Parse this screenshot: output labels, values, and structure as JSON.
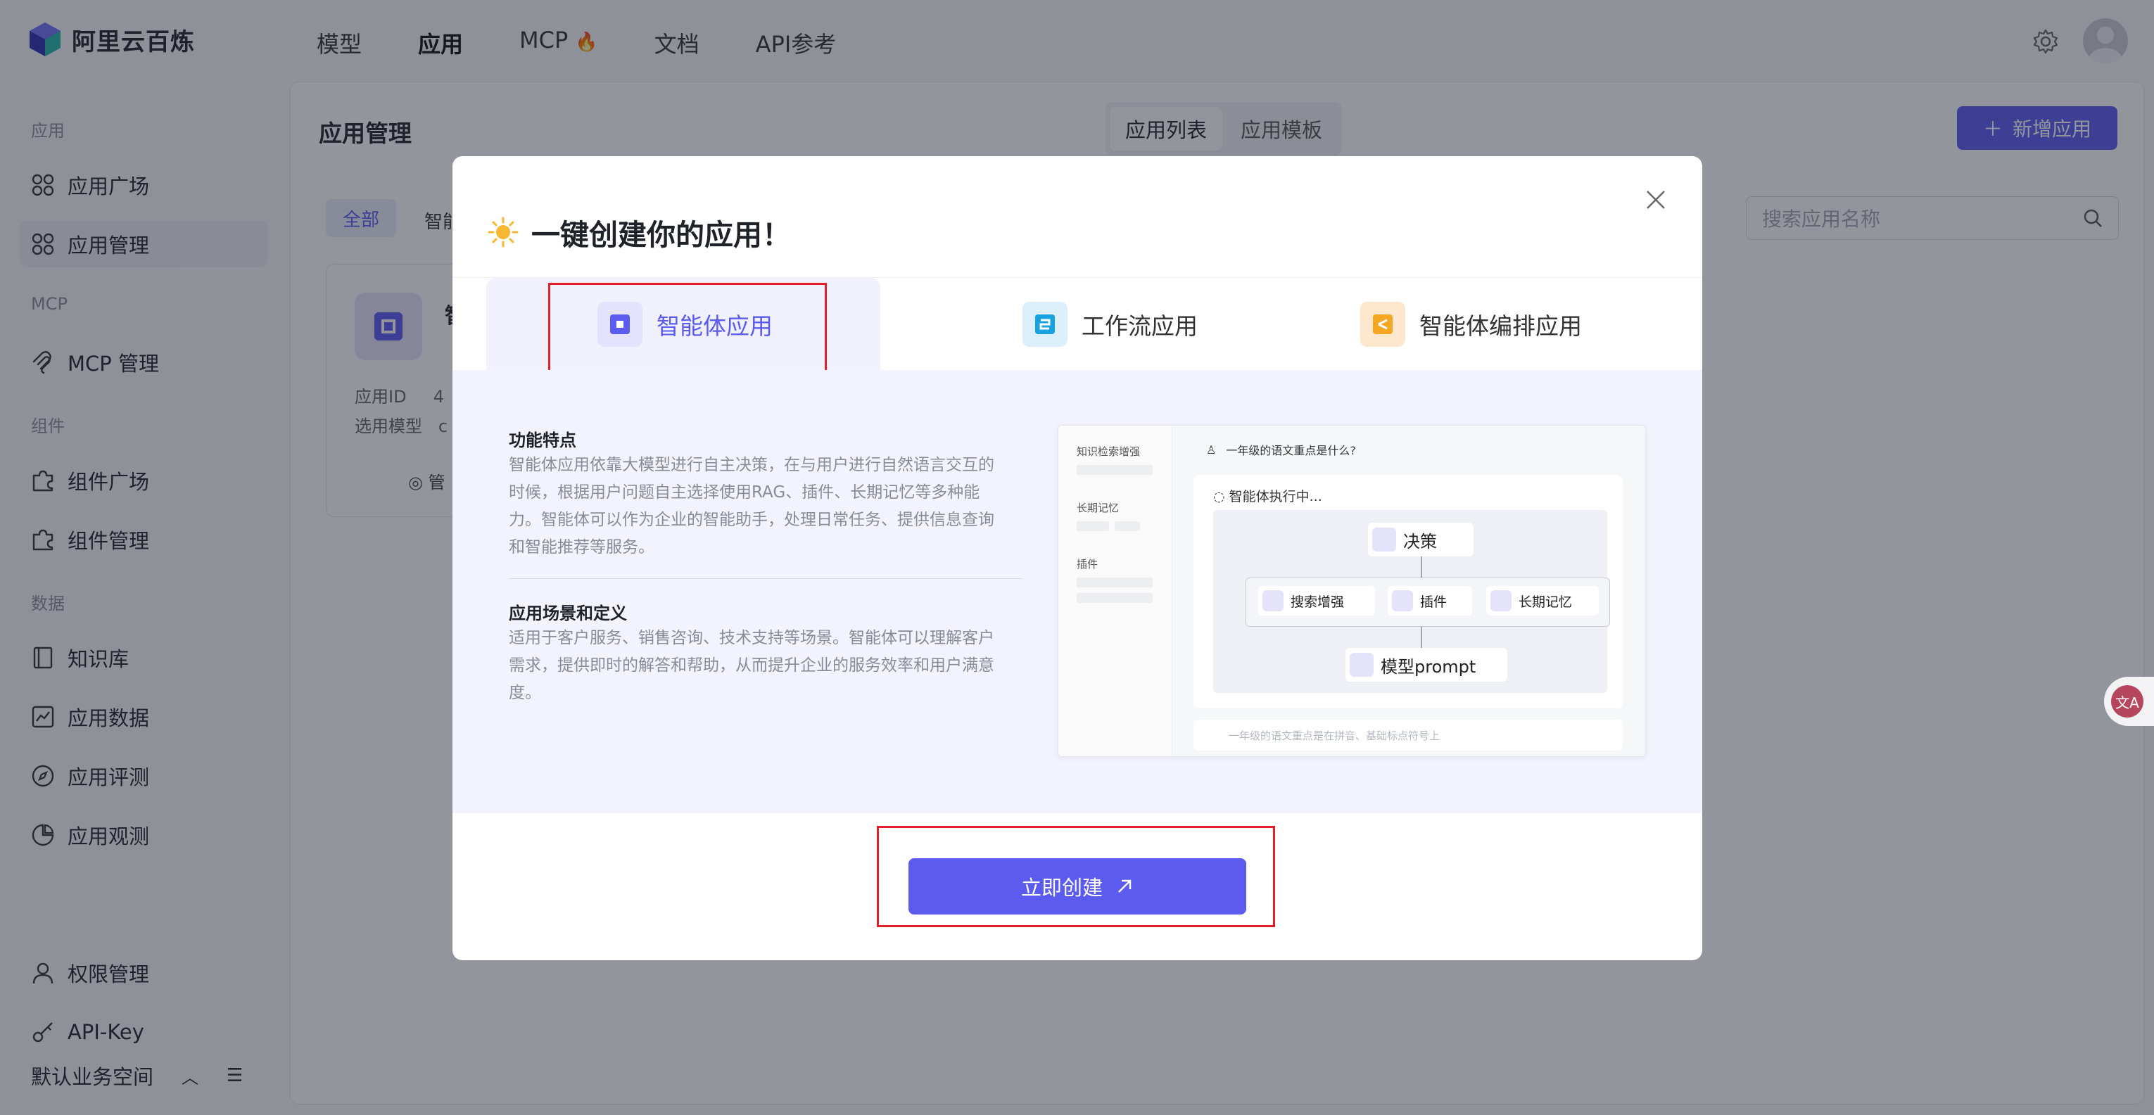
{
  "app": {
    "brand": "阿里云百炼"
  },
  "topnav": {
    "items": [
      "模型",
      "应用",
      "MCP",
      "文档",
      "API参考"
    ],
    "active": "应用"
  },
  "sidebar": {
    "groups": {
      "app": "应用",
      "mcp": "MCP",
      "component": "组件",
      "data": "数据"
    },
    "items": {
      "app_square": "应用广场",
      "app_manage": "应用管理",
      "mcp_manage": "MCP 管理",
      "comp_square": "组件广场",
      "comp_manage": "组件管理",
      "knowledge": "知识库",
      "app_data": "应用数据",
      "app_eval": "应用评测",
      "app_observe": "应用观测",
      "permission": "权限管理",
      "apikey": "API-Key"
    },
    "workspace": "默认业务空间"
  },
  "main": {
    "title": "应用管理",
    "segments": [
      "应用列表",
      "应用模板"
    ],
    "new_button": "新增应用",
    "search_placeholder": "搜索应用名称",
    "filter_all": "全部",
    "filter_2": "智能",
    "card": {
      "name": "智",
      "meta_id_label": "应用ID",
      "meta_id_val": "4",
      "meta_model_label": "选用模型",
      "meta_model_val": "c",
      "manage": "管"
    }
  },
  "modal": {
    "title": "一键创建你的应用！",
    "tabs": [
      "智能体应用",
      "工作流应用",
      "智能体编排应用"
    ],
    "active_tab": "智能体应用",
    "features_title": "功能特点",
    "features_lines": [
      "智能体应用依靠大模型进行自主决策，在与用户进行自然语言交互的",
      "时候，根据用户问题自主选择使用RAG、插件、长期记忆等多种能",
      "力。智能体可以作为企业的智能助手，处理日常任务、提供信息查询",
      "和智能推荐等服务。"
    ],
    "scenario_title": "应用场景和定义",
    "scenario_lines": [
      "适用于客户服务、销售咨询、技术支持等场景。智能体可以理解客户",
      "需求，提供即时的解答和帮助，从而提升企业的服务效率和用户满意",
      "度。"
    ],
    "preview": {
      "left_labels": [
        "知识检索增强",
        "长期记忆",
        "插件"
      ],
      "question": "一年级的语文重点是什么?",
      "running": "智能体执行中...",
      "node_decide": "决策",
      "node_search": "搜索增强",
      "node_plugin": "插件",
      "node_memory": "长期记忆",
      "node_prompt": "模型prompt",
      "input_text": "一年级的语文重点是在拼音、基础标点符号上"
    },
    "create_button": "立即创建"
  },
  "colors": {
    "accent": "#5b5bf0",
    "highlight_box": "#e0202a"
  },
  "icons": [
    "logo-icon",
    "fire-icon",
    "gear-icon",
    "avatar-icon",
    "close-icon",
    "sun-icon",
    "search-icon",
    "plus-icon",
    "arrow-up-right-icon",
    "translate-icon"
  ]
}
